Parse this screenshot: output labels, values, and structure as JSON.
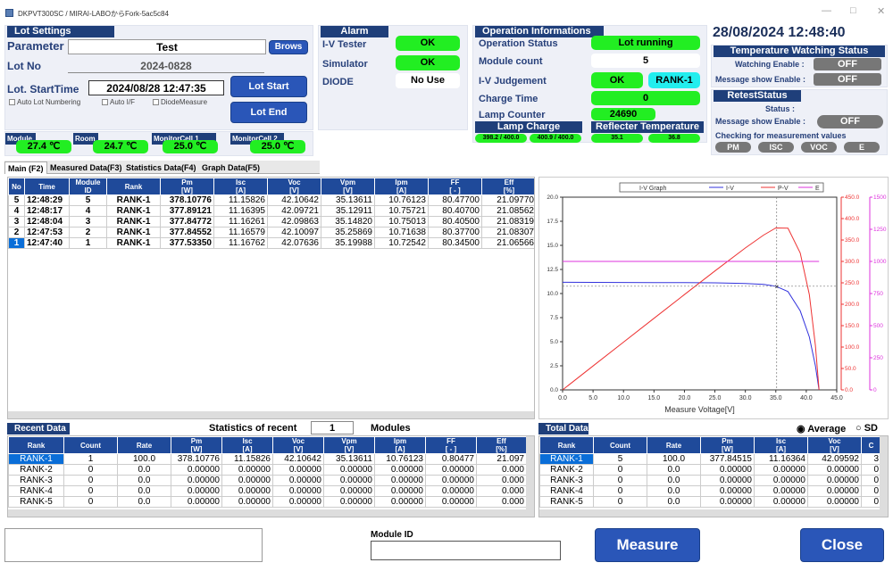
{
  "window": {
    "title": "DKPVT300SC / MIRAI-LABOからFork-5ac5c84"
  },
  "datetime": "28/08/2024 12:48:40",
  "lot": {
    "header": "Lot Settings",
    "parameter_label": "Parameter",
    "parameter_value": "Test",
    "browse_label": "Brows",
    "lotno_label": "Lot No",
    "lotno_value": "2024-0828",
    "start_label": "Lot. StartTime",
    "start_value": "2024/08/28 12:47:35",
    "lot_start_btn": "Lot Start",
    "lot_end_btn": "Lot End",
    "auto_lot": "Auto Lot Numbering",
    "auto_if": "Auto I/F",
    "diode_measure": "DiodeMeasure"
  },
  "temps": [
    {
      "label": "Module",
      "value": "27.4 ℃"
    },
    {
      "label": "Room",
      "value": "24.7 ℃"
    },
    {
      "label": "MonitorCell 1",
      "value": "25.0 ℃"
    },
    {
      "label": "MonitorCell 2",
      "value": "25.0 ℃"
    }
  ],
  "alarm": {
    "header": "Alarm",
    "iv_label": "I-V Tester",
    "iv_value": "OK",
    "sim_label": "Simulator",
    "sim_value": "OK",
    "diode_label": "DIODE",
    "diode_value": "No Use"
  },
  "ops": {
    "header": "Operation Informations",
    "status_label": "Operation Status",
    "status_value": "Lot running",
    "count_label": "Module count",
    "count_value": "5",
    "judge_label": "I-V Judgement",
    "judge_value": "OK",
    "judge_rank": "RANK-1",
    "charge_label": "Charge Time",
    "charge_value": "0",
    "lamp_label": "Lamp Counter",
    "lamp_value": "24690",
    "lamp_charge_header": "Lamp Charge",
    "lamp_charge_1": "398.2 / 400.0",
    "lamp_charge_2": "400.9 / 400.0",
    "refl_header": "Reflecter Temperature",
    "refl_1": "35.1",
    "refl_2": "36.8"
  },
  "tempwatch": {
    "header": "Temperature Watching Status",
    "watch_label": "Watching Enable :",
    "watch_value": "OFF",
    "msg_label": "Message show Enable :",
    "msg_value": "OFF"
  },
  "retest": {
    "header": "RetestStatus",
    "status_label": "Status :",
    "msg_label": "Message show Enable :",
    "msg_value": "OFF",
    "check_label": "Checking for measurement values",
    "checks": [
      "PM",
      "ISC",
      "VOC",
      "E"
    ]
  },
  "tabs": [
    "Main (F2)",
    "Measured Data(F3)",
    "Statistics Data(F4)",
    "Graph Data(F5)"
  ],
  "main_table": {
    "headers": [
      "No",
      "Time",
      "Module\nID",
      "Rank",
      "Pm\n[W]",
      "Isc\n[A]",
      "Voc\n[V]",
      "Vpm\n[V]",
      "Ipm\n[A]",
      "FF\n[ - ]",
      "Eff\n[%]"
    ],
    "rows": [
      [
        "5",
        "12:48:29",
        "5",
        "RANK-1",
        "378.10776",
        "11.15826",
        "42.10642",
        "35.13611",
        "10.76123",
        "80.47700",
        "21.09770"
      ],
      [
        "4",
        "12:48:17",
        "4",
        "RANK-1",
        "377.89121",
        "11.16395",
        "42.09721",
        "35.12911",
        "10.75721",
        "80.40700",
        "21.08562"
      ],
      [
        "3",
        "12:48:04",
        "3",
        "RANK-1",
        "377.84772",
        "11.16261",
        "42.09863",
        "35.14820",
        "10.75013",
        "80.40500",
        "21.08319"
      ],
      [
        "2",
        "12:47:53",
        "2",
        "RANK-1",
        "377.84552",
        "11.16579",
        "42.10097",
        "35.25869",
        "10.71638",
        "80.37700",
        "21.08307"
      ],
      [
        "1",
        "12:47:40",
        "1",
        "RANK-1",
        "377.53350",
        "11.16762",
        "42.07636",
        "35.19988",
        "10.72542",
        "80.34500",
        "21.06566"
      ]
    ]
  },
  "recent": {
    "header": "Recent Data",
    "stats_label": "Statistics of recent",
    "stats_value": "1",
    "modules_label": "Modules",
    "headers": [
      "Rank",
      "Count",
      "Rate",
      "Pm\n[W]",
      "Isc\n[A]",
      "Voc\n[V]",
      "Vpm\n[V]",
      "Ipm\n[A]",
      "FF\n[ - ]",
      "Eff\n[%]"
    ],
    "rows": [
      [
        "RANK-1",
        "1",
        "100.0",
        "378.10776",
        "11.15826",
        "42.10642",
        "35.13611",
        "10.76123",
        "0.80477",
        "21.097"
      ],
      [
        "RANK-2",
        "0",
        "0.0",
        "0.00000",
        "0.00000",
        "0.00000",
        "0.00000",
        "0.00000",
        "0.00000",
        "0.000"
      ],
      [
        "RANK-3",
        "0",
        "0.0",
        "0.00000",
        "0.00000",
        "0.00000",
        "0.00000",
        "0.00000",
        "0.00000",
        "0.000"
      ],
      [
        "RANK-4",
        "0",
        "0.0",
        "0.00000",
        "0.00000",
        "0.00000",
        "0.00000",
        "0.00000",
        "0.00000",
        "0.000"
      ],
      [
        "RANK-5",
        "0",
        "0.0",
        "0.00000",
        "0.00000",
        "0.00000",
        "0.00000",
        "0.00000",
        "0.00000",
        "0.000"
      ]
    ]
  },
  "total": {
    "header": "Total Data",
    "avg_label": "Average",
    "sd_label": "SD",
    "headers": [
      "Rank",
      "Count",
      "Rate",
      "Pm\n[W]",
      "Isc\n[A]",
      "Voc\n[V]",
      "C"
    ],
    "rows": [
      [
        "RANK-1",
        "5",
        "100.0",
        "377.84515",
        "11.16364",
        "42.09592",
        "3"
      ],
      [
        "RANK-2",
        "0",
        "0.0",
        "0.00000",
        "0.00000",
        "0.00000",
        "0"
      ],
      [
        "RANK-3",
        "0",
        "0.0",
        "0.00000",
        "0.00000",
        "0.00000",
        "0"
      ],
      [
        "RANK-4",
        "0",
        "0.0",
        "0.00000",
        "0.00000",
        "0.00000",
        "0"
      ],
      [
        "RANK-5",
        "0",
        "0.0",
        "0.00000",
        "0.00000",
        "0.00000",
        "0"
      ]
    ]
  },
  "bottom": {
    "module_id_label": "Module ID",
    "module_id_value": "",
    "measure_btn": "Measure",
    "close_btn": "Close"
  },
  "chart_data": {
    "type": "line",
    "title": "I-V Graph",
    "xlabel": "Measure Voltage[V]",
    "xlim": [
      0,
      45
    ],
    "ylim_left": [
      0,
      20
    ],
    "ylim_right1": [
      0,
      450
    ],
    "ylim_right2": [
      0,
      1500
    ],
    "x_ticks": [
      "0.0",
      "5.0",
      "10.0",
      "15.0",
      "20.0",
      "25.0",
      "30.0",
      "35.0",
      "40.0",
      "45.0"
    ],
    "y_left_ticks": [
      "0.0",
      "2.5",
      "5.0",
      "7.5",
      "10.0",
      "12.5",
      "15.0",
      "17.5",
      "20.0"
    ],
    "y_right1_ticks": [
      "0.0",
      "50.0",
      "100.0",
      "150.0",
      "200.0",
      "250.0",
      "300.0",
      "350.0",
      "400.0",
      "450.0"
    ],
    "y_right2_ticks": [
      "0",
      "250",
      "500",
      "750",
      "1000",
      "1250",
      "1500"
    ],
    "series": [
      {
        "name": "I-V",
        "color": "#3333dd",
        "axis": "left",
        "x": [
          0,
          5,
          10,
          15,
          20,
          25,
          30,
          33,
          35,
          37,
          39,
          40.5,
          41.5,
          42.1
        ],
        "y": [
          11.17,
          11.16,
          11.15,
          11.14,
          11.13,
          11.11,
          11.05,
          10.95,
          10.76,
          10.2,
          8.2,
          5.5,
          2.5,
          0
        ]
      },
      {
        "name": "P-V",
        "color": "#ee3333",
        "axis": "right1",
        "x": [
          0,
          5,
          10,
          15,
          20,
          25,
          30,
          33,
          35,
          37,
          39,
          40.5,
          41.5,
          42.1
        ],
        "y": [
          0,
          55.8,
          111.5,
          167.1,
          222.6,
          277.8,
          331.5,
          361.4,
          378.1,
          377.4,
          319.8,
          222.8,
          103.8,
          0
        ]
      },
      {
        "name": "E",
        "color": "#dd33dd",
        "axis": "right2",
        "x": [
          0,
          42.1
        ],
        "y": [
          1000,
          1000
        ]
      }
    ],
    "mpp": {
      "x": 35.14,
      "y": 10.76
    }
  }
}
